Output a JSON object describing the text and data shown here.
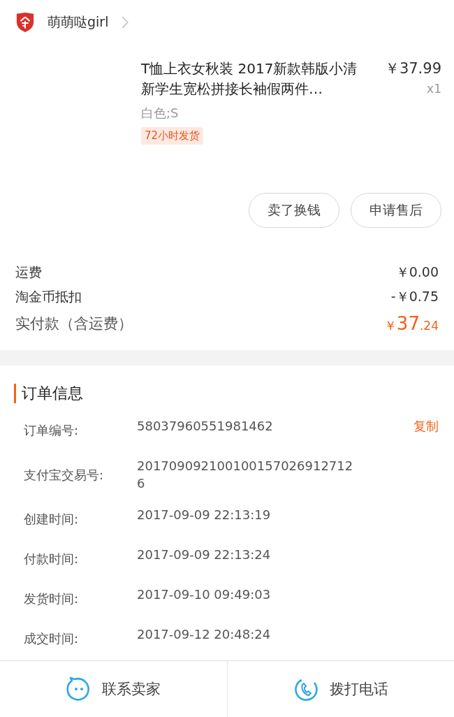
{
  "shop": {
    "name": "萌萌哒girl"
  },
  "item": {
    "title": "T恤上衣女秋装 2017新款韩版小清新学生宽松拼接长袖假两件…",
    "price": "￥37.99",
    "quantity": "x1",
    "sku": "白色;S",
    "tag": "72小时发货"
  },
  "actions": [
    "卖了换钱",
    "申请售后"
  ],
  "fees": [
    {
      "label": "运费",
      "value": "￥0.00"
    },
    {
      "label": "淘金币抵扣",
      "value": "-￥0.75"
    }
  ],
  "total": {
    "label": "实付款（含运费）",
    "currency": "￥",
    "integer": "37",
    "decimal": ".24"
  },
  "order_info": {
    "title": "订单信息",
    "copy": "复制",
    "rows": [
      {
        "label": "订单编号:",
        "value": "58037960551981462"
      },
      {
        "label": "支付宝交易号:",
        "value": "2017090921001001570269127126"
      },
      {
        "label": "创建时间:",
        "value": "2017-09-09 22:13:19"
      },
      {
        "label": "付款时间:",
        "value": "2017-09-09 22:13:24"
      },
      {
        "label": "发货时间:",
        "value": "2017-09-10 09:49:03"
      },
      {
        "label": "成交时间:",
        "value": "2017-09-12 20:48:24"
      }
    ]
  },
  "bottom_bar": [
    {
      "kind": "chat",
      "label": "联系卖家"
    },
    {
      "kind": "phone",
      "label": "拨打电话"
    }
  ]
}
